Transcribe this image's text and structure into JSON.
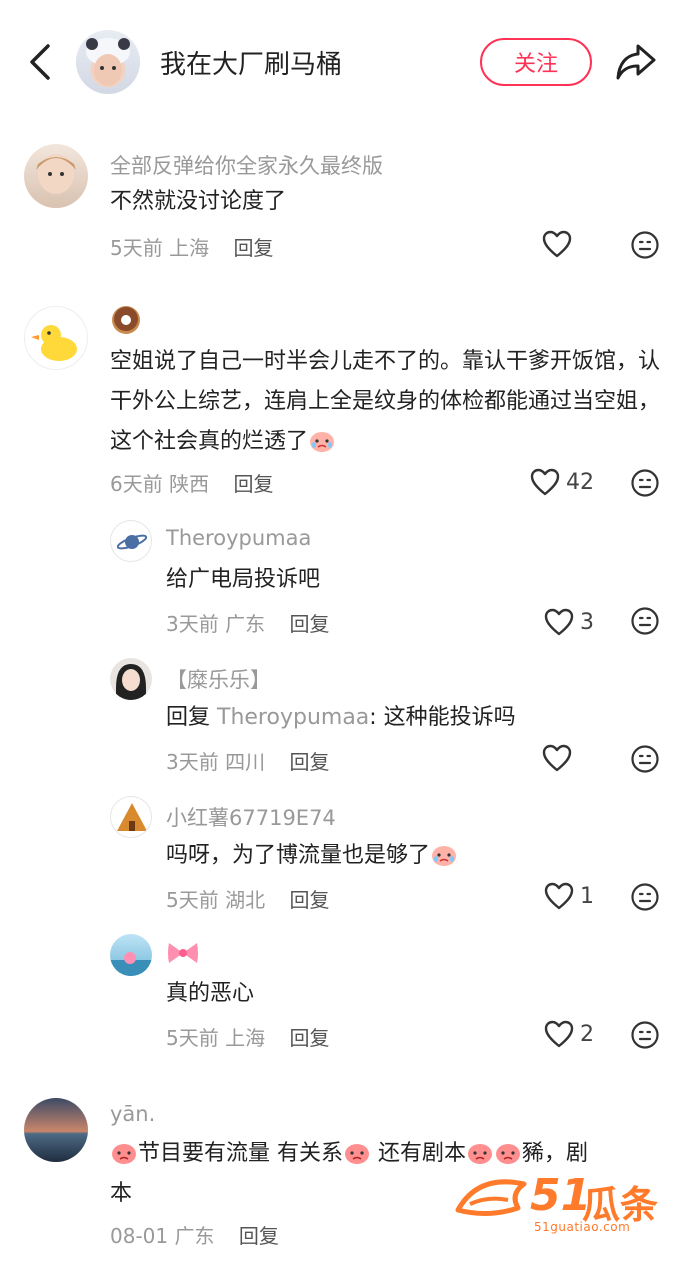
{
  "header": {
    "title": "我在大厂刷马桶",
    "follow_label": "关注"
  },
  "comments": [
    {
      "name": "全部反弹给你全家永久最终版",
      "text": "不然就没讨论度了",
      "time": "5天前",
      "location": "上海",
      "reply": "回复",
      "likes": ""
    },
    {
      "name": "",
      "text": "空姐说了自己一时半会儿走不了的。靠认干爹开饭馆，认干外公上综艺，连肩上全是纹身的体检都能通过当空姐，这个社会真的烂透了",
      "time": "6天前",
      "location": "陕西",
      "reply": "回复",
      "likes": "42"
    },
    {
      "name": "Theroypumaa",
      "text": "给广电局投诉吧",
      "time": "3天前",
      "location": "广东",
      "reply": "回复",
      "likes": "3"
    },
    {
      "name": "【糜乐乐】",
      "reply_prefix": "回复",
      "reply_target": "Theroypumaa",
      "text": ": 这种能投诉吗",
      "time": "3天前",
      "location": "四川",
      "reply": "回复",
      "likes": ""
    },
    {
      "name": "小红薯67719E74",
      "text": "吗呀，为了博流量也是够了",
      "time": "5天前",
      "location": "湖北",
      "reply": "回复",
      "likes": "1"
    },
    {
      "name": "",
      "text": "真的恶心",
      "time": "5天前",
      "location": "上海",
      "reply": "回复",
      "likes": "2"
    },
    {
      "name": "yān.",
      "text_a": "节目要有流量 有关系",
      "text_b": " 还有剧本",
      "text_c": "豨，剧",
      "text_d": "本",
      "time": "08-01",
      "location": "广东",
      "reply": "回复",
      "likes": ""
    }
  ],
  "watermark": {
    "number": "51",
    "brand": "瓜条",
    "url": "51guatiao.com"
  },
  "icons": {
    "back": "chevron-left-icon",
    "share": "share-arrow-icon",
    "like": "heart-outline-icon",
    "dislike": "neutral-face-icon"
  },
  "colors": {
    "accent": "#ff3355",
    "watermark": "#ff7a2a",
    "muted": "#999999"
  }
}
